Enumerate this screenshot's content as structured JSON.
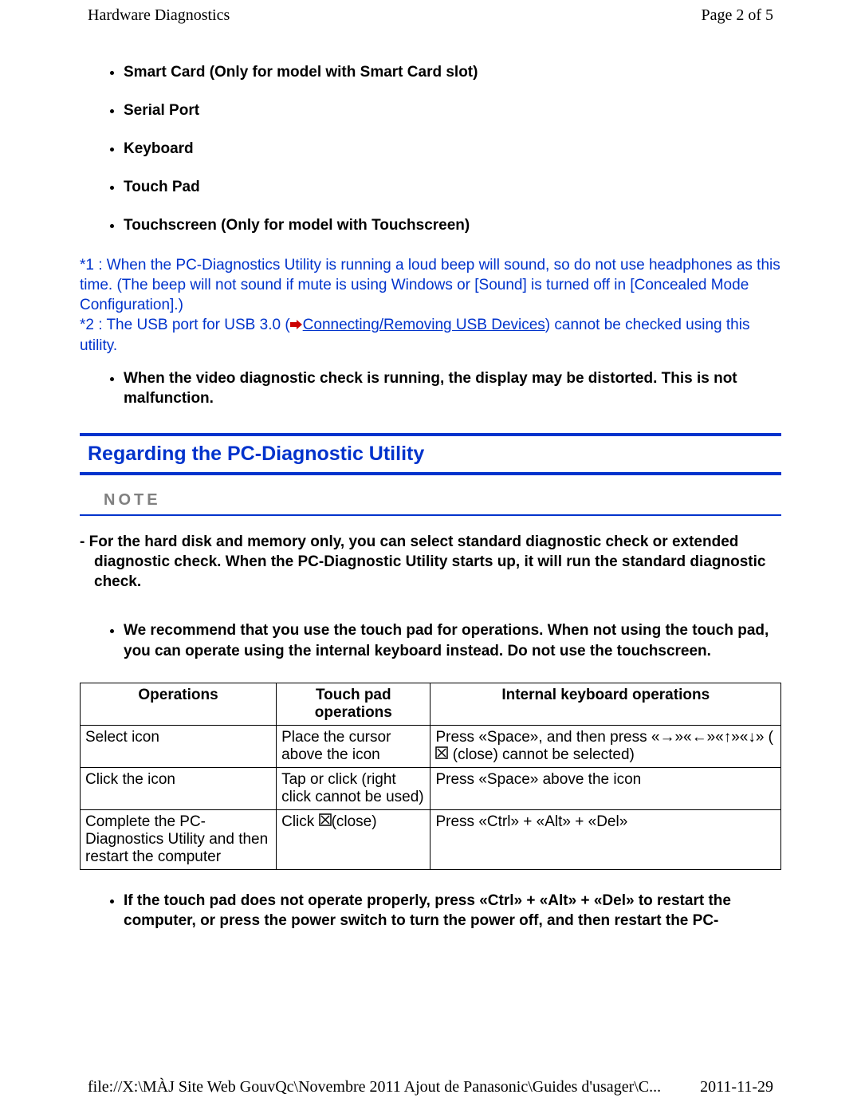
{
  "header": {
    "title": "Hardware Diagnostics",
    "page": "Page 2 of 5"
  },
  "features": [
    "Smart Card (Only for model with Smart Card slot)",
    "Serial Port",
    "Keyboard",
    "Touch Pad",
    "Touchscreen (Only for model with Touchscreen)"
  ],
  "footnotes": {
    "n1": "*1 : When the PC-Diagnostics Utility is running a loud beep will sound, so do not use headphones as this time. (The beep will not sound if mute is using Windows or [Sound] is turned off in [Concealed Mode Configuration].)",
    "n2a": "*2 : The USB port for USB 3.0 (",
    "n2link": "Connecting/Removing USB Devices",
    "n2b": ") cannot be checked using this utility."
  },
  "video_warn": "When the video diagnostic check is running, the display may be distorted. This is not malfunction.",
  "section_title": "Regarding the PC-Diagnostic Utility",
  "note_label": "NOTE",
  "hd_note": "- For the hard disk and memory only, you can select standard diagnostic check or extended diagnostic check. When the PC-Diagnostic Utility starts up, it will run the standard diagnostic check.",
  "recommend": "We recommend that you use the touch pad for operations. When not using the touch pad, you can operate using the internal keyboard instead. Do not use the touchscreen.",
  "table": {
    "headers": [
      "Operations",
      "Touch pad operations",
      "Internal keyboard operations"
    ],
    "rows": [
      {
        "op": "Select icon",
        "tp": "Place the cursor above the icon",
        "kb_a": "Press «Space», and then press «→»«←»«↑»«↓» (",
        "kb_b": " (close) cannot be selected)"
      },
      {
        "op": "Click the icon",
        "tp": "Tap or click (right click cannot be used)",
        "kb": "Press «Space» above the icon"
      },
      {
        "op": "Complete the PC-Diagnostics Utility and then restart the computer",
        "tp_a": "Click ",
        "tp_b": "(close)",
        "kb": "Press «Ctrl» + «Alt» + «Del»"
      }
    ]
  },
  "post_note": "If the touch pad does not operate properly, press «Ctrl» + «Alt» + «Del» to restart the computer, or press the power switch to turn the power off, and then restart the PC-",
  "footer": {
    "path": "file://X:\\MÀJ Site Web GouvQc\\Novembre 2011 Ajout de Panasonic\\Guides d'usager\\C...",
    "date": "2011-11-29"
  }
}
